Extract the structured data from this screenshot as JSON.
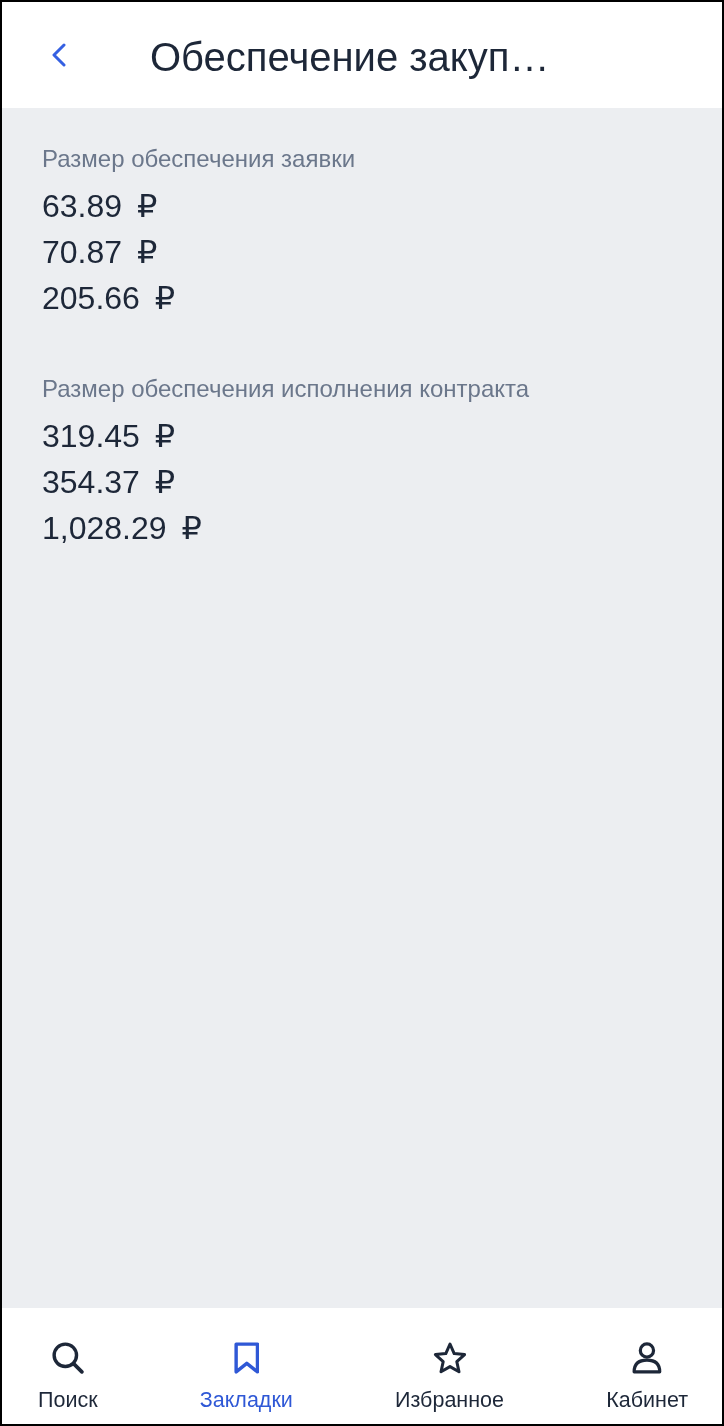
{
  "header": {
    "title": "Обеспечение закуп…"
  },
  "sections": [
    {
      "label": "Размер обеспечения заявки",
      "values": [
        "63.89 ₽",
        "70.87 ₽",
        "205.66 ₽"
      ]
    },
    {
      "label": "Размер обеспечения исполнения контракта",
      "values": [
        "319.45 ₽",
        "354.37 ₽",
        "1,028.29 ₽"
      ]
    }
  ],
  "bottom_nav": [
    {
      "kind": "search",
      "label": "Поиск",
      "selected": false
    },
    {
      "kind": "bookmarks",
      "label": "Закладки",
      "selected": true
    },
    {
      "kind": "favorites",
      "label": "Избранное",
      "selected": false
    },
    {
      "kind": "account",
      "label": "Кабинет",
      "selected": false
    }
  ]
}
